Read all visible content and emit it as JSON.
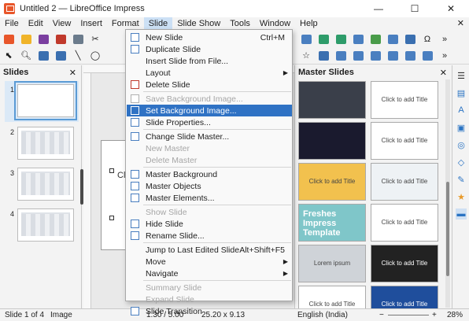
{
  "window": {
    "title": "Untitled 2 — LibreOffice Impress",
    "minimize": "—",
    "maximize": "☐",
    "close": "✕"
  },
  "menubar": {
    "items": [
      "File",
      "Edit",
      "View",
      "Insert",
      "Format",
      "Slide",
      "Slide Show",
      "Tools",
      "Window",
      "Help"
    ],
    "active": "Slide",
    "close_doc": "✕"
  },
  "slides_pane": {
    "title": "Slides",
    "close": "✕",
    "numbers": [
      "1",
      "2",
      "3",
      "4"
    ]
  },
  "editor": {
    "visible_fragment": "Cli"
  },
  "master_pane": {
    "title": "Master Slides",
    "close": "✕",
    "thumbs": [
      {
        "text": "",
        "bg": "#3a3f4a"
      },
      {
        "text": "Click to add Title",
        "bg": "#ffffff"
      },
      {
        "text": "",
        "bg": "#1a1a2e"
      },
      {
        "text": "Click to add Title",
        "bg": "#ffffff"
      },
      {
        "text": "Click to add Title",
        "bg": "#f2c14e"
      },
      {
        "text": "Click to add Title",
        "bg": "#eef2f5"
      },
      {
        "text": "Freshes Impress Template",
        "bg": "#7fc6c9"
      },
      {
        "text": "Click to add Title",
        "bg": "#ffffff"
      },
      {
        "text": "Lorem ipsum",
        "bg": "#cfd3d8"
      },
      {
        "text": "Click to add Title",
        "bg": "#222222"
      },
      {
        "text": "Click to add Title",
        "bg": "#ffffff"
      },
      {
        "text": "Click to add Title",
        "bg": "#1f4e9c"
      }
    ]
  },
  "slide_menu": {
    "items": [
      {
        "label": "New Slide",
        "shortcut": "Ctrl+M",
        "icon_color": "#4a7fc0",
        "state": "normal"
      },
      {
        "label": "Duplicate Slide",
        "shortcut": "",
        "icon_color": "#4a7fc0",
        "state": "normal"
      },
      {
        "label": "Insert Slide from File...",
        "shortcut": "",
        "icon_color": "",
        "state": "normal"
      },
      {
        "label": "Layout",
        "shortcut": "",
        "icon_color": "",
        "state": "submenu"
      },
      {
        "label": "Delete Slide",
        "shortcut": "",
        "icon_color": "#c0392b",
        "state": "normal"
      },
      {
        "sep": true
      },
      {
        "label": "Save Background Image...",
        "shortcut": "",
        "icon_color": "#b0b0b0",
        "state": "disabled"
      },
      {
        "label": "Set Background Image...",
        "shortcut": "",
        "icon_color": "#ffffff",
        "state": "highlight"
      },
      {
        "label": "Slide Properties...",
        "shortcut": "",
        "icon_color": "#4a7fc0",
        "state": "normal"
      },
      {
        "sep": true
      },
      {
        "label": "Change Slide Master...",
        "shortcut": "",
        "icon_color": "#4a7fc0",
        "state": "normal"
      },
      {
        "label": "New Master",
        "shortcut": "",
        "icon_color": "",
        "state": "disabled"
      },
      {
        "label": "Delete Master",
        "shortcut": "",
        "icon_color": "",
        "state": "disabled"
      },
      {
        "sep": true
      },
      {
        "label": "Master Background",
        "shortcut": "",
        "icon_color": "#4a7fc0",
        "state": "normal"
      },
      {
        "label": "Master Objects",
        "shortcut": "",
        "icon_color": "#4a7fc0",
        "state": "normal"
      },
      {
        "label": "Master Elements...",
        "shortcut": "",
        "icon_color": "#4a7fc0",
        "state": "normal"
      },
      {
        "sep": true
      },
      {
        "label": "Show Slide",
        "shortcut": "",
        "icon_color": "",
        "state": "disabled"
      },
      {
        "label": "Hide Slide",
        "shortcut": "",
        "icon_color": "#4a7fc0",
        "state": "normal"
      },
      {
        "label": "Rename Slide...",
        "shortcut": "",
        "icon_color": "#4a7fc0",
        "state": "normal"
      },
      {
        "sep": true
      },
      {
        "label": "Jump to Last Edited Slide",
        "shortcut": "Alt+Shift+F5",
        "icon_color": "",
        "state": "normal"
      },
      {
        "label": "Move",
        "shortcut": "",
        "icon_color": "",
        "state": "submenu"
      },
      {
        "label": "Navigate",
        "shortcut": "",
        "icon_color": "",
        "state": "submenu"
      },
      {
        "sep": true
      },
      {
        "label": "Summary Slide",
        "shortcut": "",
        "icon_color": "",
        "state": "disabled"
      },
      {
        "label": "Expand Slide",
        "shortcut": "",
        "icon_color": "",
        "state": "disabled"
      },
      {
        "label": "Slide Transition",
        "shortcut": "",
        "icon_color": "#4a7fc0",
        "state": "normal"
      }
    ]
  },
  "statusbar": {
    "slide_count": "Slide 1 of 4",
    "mode": "Image",
    "position": "1.30 / 5.00",
    "size": "25.20 x 9.13",
    "language": "English (India)",
    "zoom_minus": "−",
    "zoom_plus": "+",
    "zoom": "28%"
  }
}
